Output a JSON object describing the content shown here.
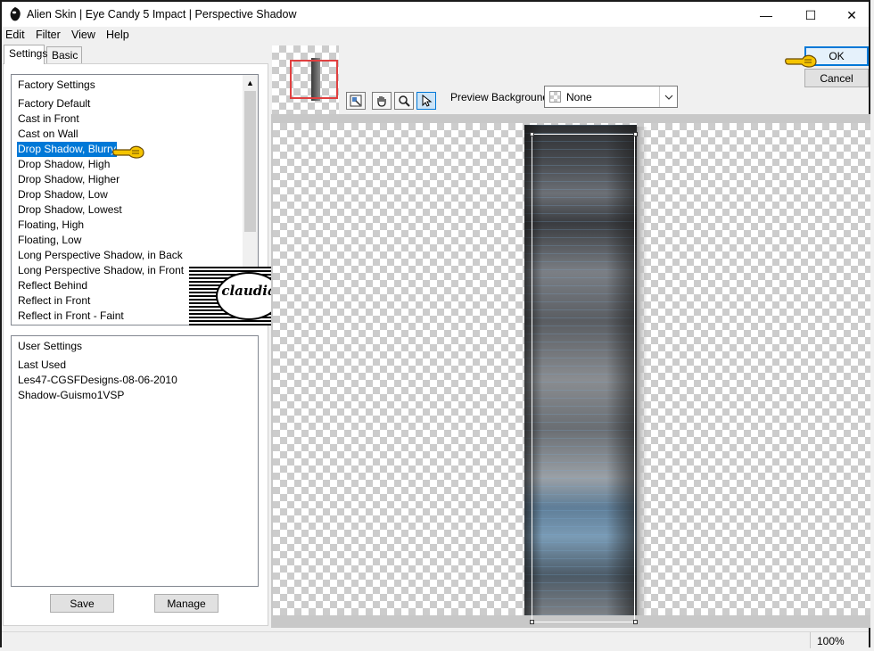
{
  "window": {
    "title": "Alien Skin | Eye Candy 5 Impact | Perspective Shadow",
    "minimize_glyph": "—",
    "maximize_glyph": "☐",
    "close_glyph": "✕"
  },
  "menu": [
    "Edit",
    "Filter",
    "View",
    "Help"
  ],
  "tabs": [
    "Settings",
    "Basic"
  ],
  "factory_settings": {
    "header": "Factory Settings",
    "items": [
      "Factory Default",
      "Cast in Front",
      "Cast on Wall",
      "Drop Shadow, Blurry",
      "Drop Shadow, High",
      "Drop Shadow, Higher",
      "Drop Shadow, Low",
      "Drop Shadow, Lowest",
      "Floating, High",
      "Floating, Low",
      "Long Perspective Shadow, in Back",
      "Long Perspective Shadow, in Front",
      "Reflect Behind",
      "Reflect in Front",
      "Reflect in Front - Faint"
    ],
    "selected_index": 3
  },
  "user_settings": {
    "header": "User Settings",
    "items": [
      "Last Used",
      "Les47-CGSFDesigns-08-06-2010",
      "Shadow-Guismo1VSP"
    ]
  },
  "buttons": {
    "save": "Save",
    "manage": "Manage",
    "ok": "OK",
    "cancel": "Cancel"
  },
  "preview_background": {
    "label": "Preview Background:",
    "value": "None"
  },
  "watermark": {
    "text": "claudia"
  },
  "status": {
    "zoom": "100%"
  },
  "colors": {
    "selection": "#0078d7",
    "pointer_hand": "#f5c400",
    "checker_dark": "#cccccc"
  }
}
